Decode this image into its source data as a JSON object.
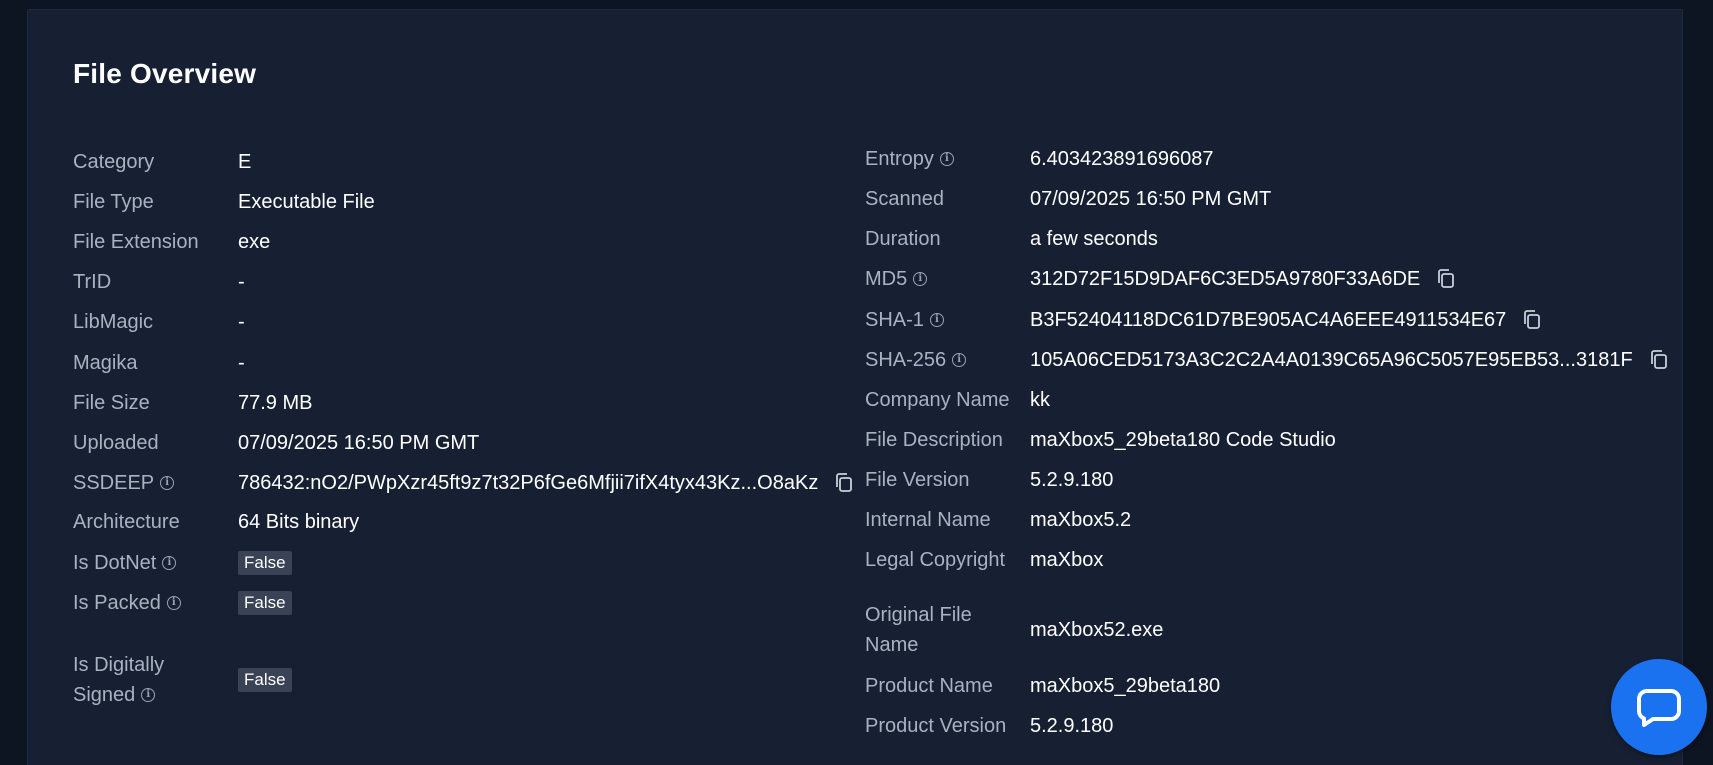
{
  "title": "File Overview",
  "left": [
    {
      "label": "Category",
      "value": "E"
    },
    {
      "label": "File Type",
      "value": "Executable File"
    },
    {
      "label": "File Extension",
      "value": "exe"
    },
    {
      "label": "TrID",
      "value": "-"
    },
    {
      "label": "LibMagic",
      "value": "-"
    },
    {
      "label": "Magika",
      "value": "-"
    },
    {
      "label": "File Size",
      "value": "77.9 MB"
    },
    {
      "label": "Uploaded",
      "value": "07/09/2025 16:50 PM GMT"
    },
    {
      "label": "SSDEEP",
      "value": "786432:nO2/PWpXzr45ft9z7t32P6fGe6Mfjii7ifX4tyx43Kz...O8aKz"
    },
    {
      "label": "Architecture",
      "value": "64 Bits binary"
    },
    {
      "label": "Is DotNet",
      "value": "False"
    },
    {
      "label": "Is Packed",
      "value": "False"
    },
    {
      "label_line1": "Is Digitally",
      "label_line2": "Signed",
      "value": "False"
    }
  ],
  "right": [
    {
      "label": "Entropy",
      "value": "6.403423891696087"
    },
    {
      "label": "Scanned",
      "value": "07/09/2025 16:50 PM GMT"
    },
    {
      "label": "Duration",
      "value": "a few seconds"
    },
    {
      "label": "MD5",
      "value": "312D72F15D9DAF6C3ED5A9780F33A6DE"
    },
    {
      "label": "SHA-1",
      "value": "B3F52404118DC61D7BE905AC4A6EEE4911534E67"
    },
    {
      "label": "SHA-256",
      "value": "105A06CED5173A3C2C2A4A0139C65A96C5057E95EB53...3181F"
    },
    {
      "label": "Company Name",
      "value": "kk"
    },
    {
      "label": "File Description",
      "value": "maXbox5_29beta180 Code Studio"
    },
    {
      "label": "File Version",
      "value": "5.2.9.180"
    },
    {
      "label": "Internal Name",
      "value": "maXbox5.2"
    },
    {
      "label": "Legal Copyright",
      "value": "maXbox"
    },
    {
      "label_line1": "Original File",
      "label_line2": "Name",
      "value": "maXbox52.exe"
    },
    {
      "label": "Product Name",
      "value": "maXbox5_29beta180"
    },
    {
      "label": "Product Version",
      "value": "5.2.9.180"
    }
  ],
  "icons": {
    "info": "info-icon",
    "copy": "copy-icon",
    "chat": "chat-icon"
  },
  "colors": {
    "background": "#0d1422",
    "panel": "#172033",
    "label": "#aab2c0",
    "value": "#ffffff",
    "badge": "#3a4356",
    "chat_button": "#1a72f0"
  }
}
